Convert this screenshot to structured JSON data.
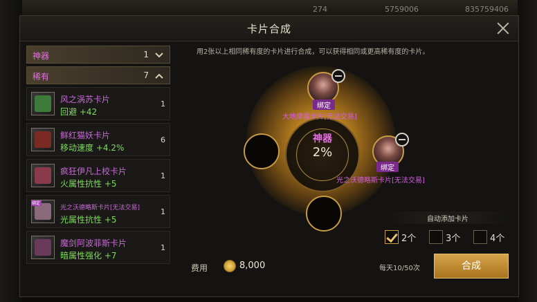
{
  "background": {
    "resources": [
      "274",
      "5759006",
      "835759406"
    ]
  },
  "dialog": {
    "title": "卡片合成",
    "hint": "用2张以上相同稀有度的卡片进行合成，可以获得相同或更高稀有度的卡片。"
  },
  "categories": [
    {
      "name": "神器",
      "count": "1",
      "expanded": false
    },
    {
      "name": "稀有",
      "count": "7",
      "expanded": true
    }
  ],
  "cards": [
    {
      "name": "风之涡苏卡片",
      "stat": "回避 +42",
      "count": "1",
      "color": "#3e7a3a"
    },
    {
      "name": "鲜红猫妖卡片",
      "stat": "移动速度 +4.2%",
      "count": "6",
      "color": "#7a2a22"
    },
    {
      "name": "疯狂伊凡上校卡片",
      "stat": "火属性抗性 +5",
      "count": "1",
      "color": "#8a3a4a"
    },
    {
      "name": "光之沃德略斯卡片[无法交易]",
      "stat": "光属性抗性 +5",
      "count": "1",
      "color": "#8a6a7a",
      "tag": "绑定"
    },
    {
      "name": "魔剑阿波菲斯卡片",
      "stat": "暗属性强化 +7",
      "count": "1",
      "color": "#6a3a5a"
    }
  ],
  "synthesis": {
    "rarity": "神器",
    "chance": "2%",
    "slots": [
      {
        "bind": "绑定",
        "name": "大地摩震卡片[无法交易]"
      },
      {
        "bind": "绑定",
        "name": "光之沃德略斯卡片[无法交易]"
      }
    ]
  },
  "auto_add": {
    "label": "自动添加卡片",
    "options": [
      {
        "label": "2个",
        "checked": true
      },
      {
        "label": "3个",
        "checked": false
      },
      {
        "label": "4个",
        "checked": false
      }
    ]
  },
  "footer": {
    "fee_label": "费用",
    "fee_value": "8,000",
    "daily": "每天10/50次",
    "button": "合成"
  }
}
